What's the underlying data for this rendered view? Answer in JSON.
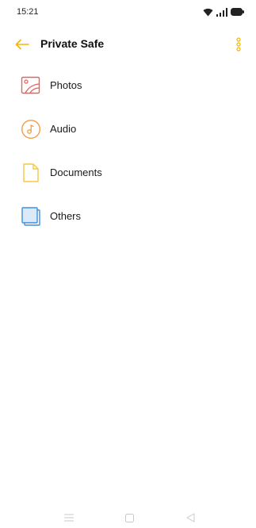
{
  "status_bar": {
    "time": "15:21",
    "icons": [
      "wifi-icon",
      "signal-icon",
      "battery-icon"
    ]
  },
  "app_bar": {
    "title": "Private Safe",
    "back_icon": "back-arrow-icon",
    "menu_icon": "more-options-icon",
    "accent_color": "#f5b400"
  },
  "categories": [
    {
      "label": "Photos",
      "icon": "photos-icon",
      "color": "#e8615a"
    },
    {
      "label": "Audio",
      "icon": "audio-icon",
      "color": "#f39c45"
    },
    {
      "label": "Documents",
      "icon": "documents-icon",
      "color": "#f5c842"
    },
    {
      "label": "Others",
      "icon": "others-icon",
      "color": "#3d8fe0"
    }
  ],
  "nav_bar": {
    "buttons": [
      "menu-nav-icon",
      "home-nav-icon",
      "back-nav-icon"
    ]
  }
}
